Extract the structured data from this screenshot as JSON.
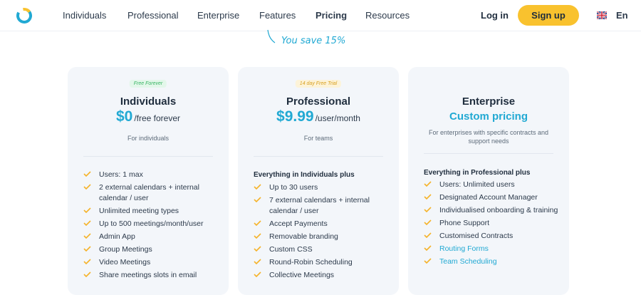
{
  "nav": {
    "items": [
      "Individuals",
      "Professional",
      "Enterprise",
      "Features",
      "Pricing",
      "Resources"
    ],
    "active": "Pricing",
    "login": "Log in",
    "signup": "Sign up",
    "lang": "En"
  },
  "save_text": "You save 15%",
  "colors": {
    "accent": "#21a9d3",
    "yellow": "#f9c22e",
    "card_bg": "#f3f6fa",
    "check": "#f5b32a"
  },
  "plans": [
    {
      "badge": "Free Forever",
      "name": "Individuals",
      "price": "$0",
      "price_unit": "/free forever",
      "desc": "For individuals",
      "features": [
        "Users: 1 max",
        "2 external calendars + internal calendar / user",
        "Unlimited meeting types",
        "Up to 500 meetings/month/user",
        "Admin App",
        "Group Meetings",
        "Video Meetings",
        "Share meetings slots in email"
      ]
    },
    {
      "badge": "14 day Free Trial",
      "name": "Professional",
      "price": "$9.99",
      "price_unit": "/user/month",
      "desc": "For teams",
      "features_head": "Everything in Individuals plus",
      "features": [
        "Up to 30 users",
        "7 external calendars + internal calendar / user",
        "Accept Payments",
        "Removable branding",
        "Custom CSS",
        "Round-Robin Scheduling",
        "Collective Meetings"
      ]
    },
    {
      "name": "Enterprise",
      "price_text": "Custom pricing",
      "desc": "For enterprises with specific contracts and support needs",
      "features_head": "Everything in Professional plus",
      "features": [
        "Users: Unlimited users",
        "Designated Account Manager",
        "Individualised onboarding & training",
        "Phone Support",
        "Customised Contracts",
        "Routing Forms",
        "Team Scheduling"
      ]
    }
  ]
}
